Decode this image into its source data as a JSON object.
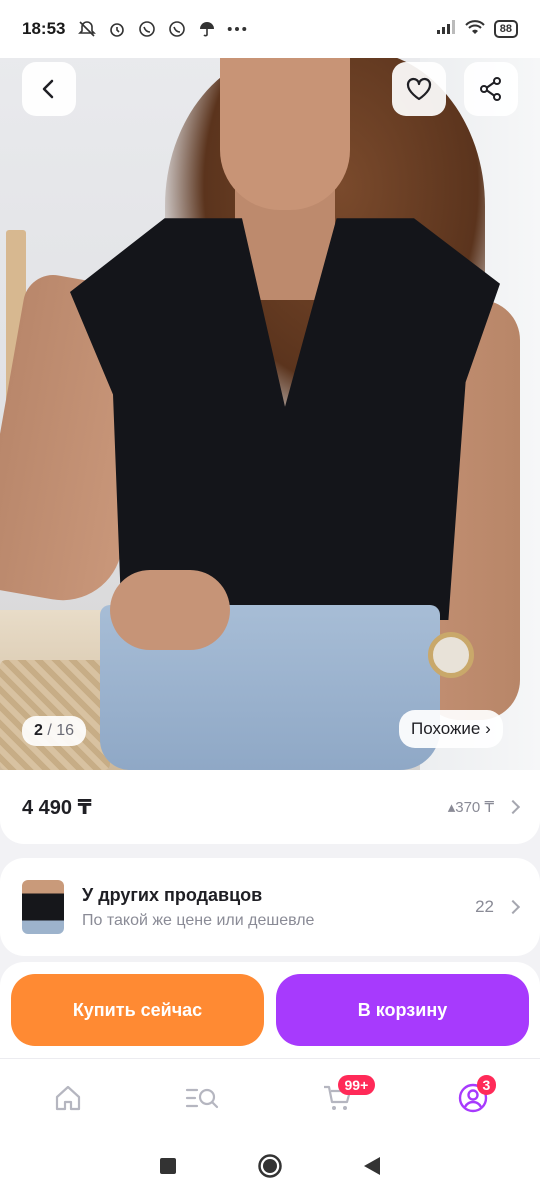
{
  "status_bar": {
    "time": "18:53",
    "left_icons": [
      "silent-alarm-icon",
      "alarm-clock-icon",
      "whatsapp-icon",
      "whatsapp-icon",
      "umbrella-icon",
      "more-dots-icon"
    ],
    "right_icons": [
      "signal-icon",
      "wifi-icon"
    ],
    "battery": "88"
  },
  "photo": {
    "current_index": "2",
    "separator": "/",
    "total": "16",
    "similar_label": "Похожие ›"
  },
  "price_card": {
    "price": "4 490 ₸",
    "cashback": "▴370 ₸"
  },
  "other_sellers": {
    "title": "У других продавцов",
    "subtitle": "По такой же цене или дешевле",
    "count": "22"
  },
  "actions": {
    "buy_now": "Купить сейчас",
    "add_to_cart": "В корзину"
  },
  "bottom_nav": {
    "cart_badge": "99+",
    "profile_badge": "3"
  },
  "colors": {
    "buy_button": "#ff8a33",
    "cart_button": "#a73afd",
    "badge": "#ff2a58",
    "active_profile": "#a73afd"
  }
}
